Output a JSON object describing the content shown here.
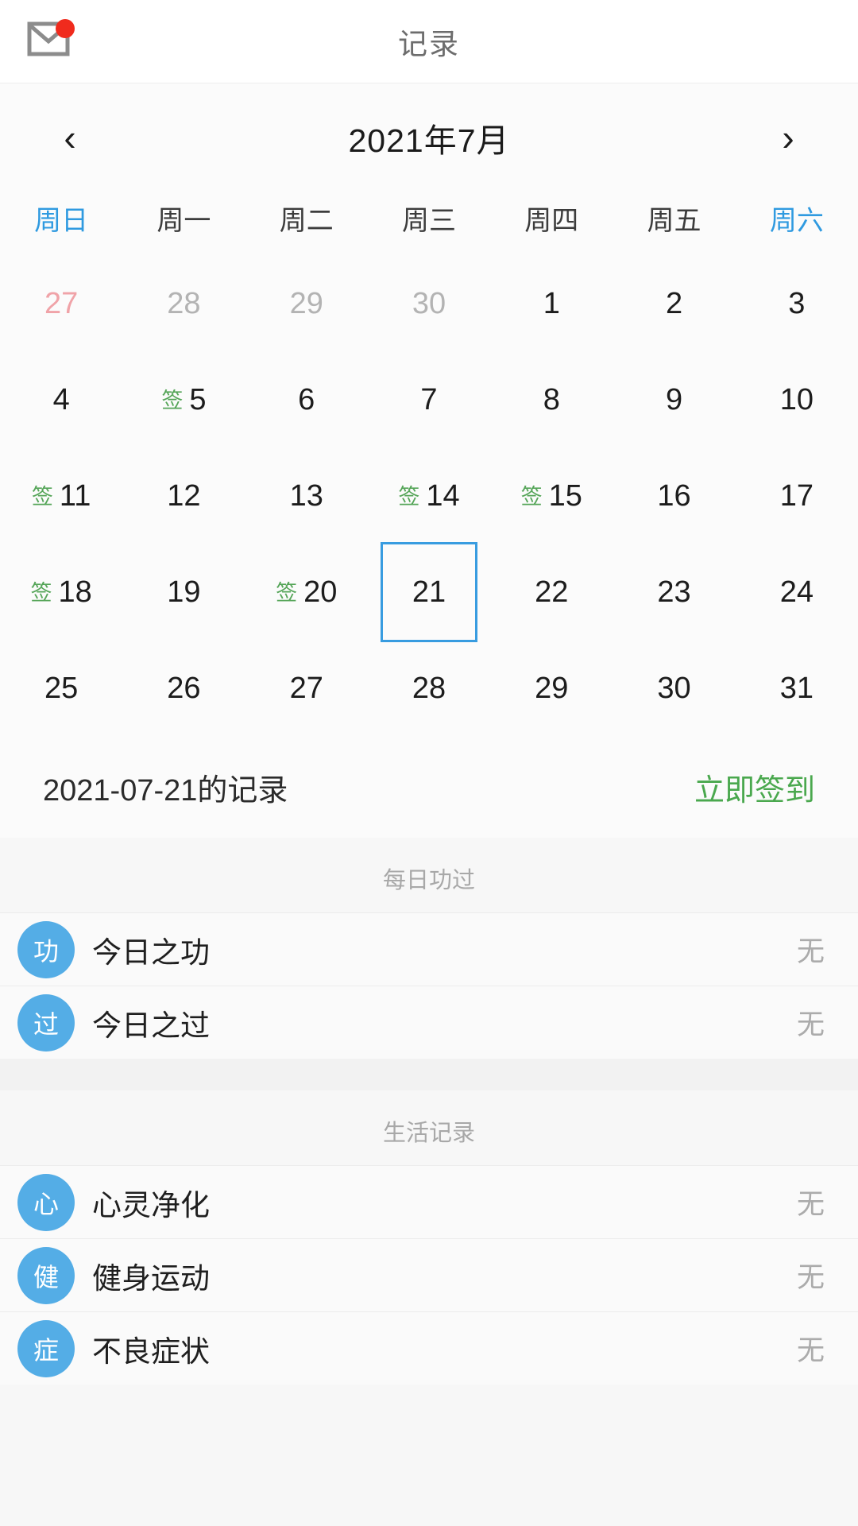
{
  "header": {
    "mail_icon": "mail-icon",
    "badge": "notification-dot",
    "title": "记录"
  },
  "calendar": {
    "prev_label": "‹",
    "next_label": "›",
    "month_label": "2021年7月",
    "weekdays": [
      {
        "label": "周日",
        "accent": true
      },
      {
        "label": "周一",
        "accent": false
      },
      {
        "label": "周二",
        "accent": false
      },
      {
        "label": "周三",
        "accent": false
      },
      {
        "label": "周四",
        "accent": false
      },
      {
        "label": "周五",
        "accent": false
      },
      {
        "label": "周六",
        "accent": true
      }
    ],
    "sign_mark": "签",
    "weeks": [
      [
        {
          "day": "27",
          "state": "pink",
          "signed": false,
          "selected": false
        },
        {
          "day": "28",
          "state": "muted",
          "signed": false,
          "selected": false
        },
        {
          "day": "29",
          "state": "muted",
          "signed": false,
          "selected": false
        },
        {
          "day": "30",
          "state": "muted",
          "signed": false,
          "selected": false
        },
        {
          "day": "1",
          "state": "current",
          "signed": false,
          "selected": false
        },
        {
          "day": "2",
          "state": "current",
          "signed": false,
          "selected": false
        },
        {
          "day": "3",
          "state": "current",
          "signed": false,
          "selected": false
        }
      ],
      [
        {
          "day": "4",
          "state": "current",
          "signed": false,
          "selected": false
        },
        {
          "day": "5",
          "state": "current",
          "signed": true,
          "selected": false
        },
        {
          "day": "6",
          "state": "current",
          "signed": false,
          "selected": false
        },
        {
          "day": "7",
          "state": "current",
          "signed": false,
          "selected": false
        },
        {
          "day": "8",
          "state": "current",
          "signed": false,
          "selected": false
        },
        {
          "day": "9",
          "state": "current",
          "signed": false,
          "selected": false
        },
        {
          "day": "10",
          "state": "current",
          "signed": false,
          "selected": false
        }
      ],
      [
        {
          "day": "11",
          "state": "current",
          "signed": true,
          "selected": false
        },
        {
          "day": "12",
          "state": "current",
          "signed": false,
          "selected": false
        },
        {
          "day": "13",
          "state": "current",
          "signed": false,
          "selected": false
        },
        {
          "day": "14",
          "state": "current",
          "signed": true,
          "selected": false
        },
        {
          "day": "15",
          "state": "current",
          "signed": true,
          "selected": false
        },
        {
          "day": "16",
          "state": "current",
          "signed": false,
          "selected": false
        },
        {
          "day": "17",
          "state": "current",
          "signed": false,
          "selected": false
        }
      ],
      [
        {
          "day": "18",
          "state": "current",
          "signed": true,
          "selected": false
        },
        {
          "day": "19",
          "state": "current",
          "signed": false,
          "selected": false
        },
        {
          "day": "20",
          "state": "current",
          "signed": true,
          "selected": false
        },
        {
          "day": "21",
          "state": "current",
          "signed": false,
          "selected": true
        },
        {
          "day": "22",
          "state": "current",
          "signed": false,
          "selected": false
        },
        {
          "day": "23",
          "state": "current",
          "signed": false,
          "selected": false
        },
        {
          "day": "24",
          "state": "current",
          "signed": false,
          "selected": false
        }
      ],
      [
        {
          "day": "25",
          "state": "current",
          "signed": false,
          "selected": false
        },
        {
          "day": "26",
          "state": "current",
          "signed": false,
          "selected": false
        },
        {
          "day": "27",
          "state": "current",
          "signed": false,
          "selected": false
        },
        {
          "day": "28",
          "state": "current",
          "signed": false,
          "selected": false
        },
        {
          "day": "29",
          "state": "current",
          "signed": false,
          "selected": false
        },
        {
          "day": "30",
          "state": "current",
          "signed": false,
          "selected": false
        },
        {
          "day": "31",
          "state": "current",
          "signed": false,
          "selected": false
        }
      ]
    ]
  },
  "record_header": {
    "title": "2021-07-21的记录",
    "action": "立即签到"
  },
  "sections": [
    {
      "title": "每日功过",
      "rows": [
        {
          "avatar": "功",
          "label": "今日之功",
          "value": "无"
        },
        {
          "avatar": "过",
          "label": "今日之过",
          "value": "无"
        }
      ]
    },
    {
      "title": "生活记录",
      "rows": [
        {
          "avatar": "心",
          "label": "心灵净化",
          "value": "无"
        },
        {
          "avatar": "健",
          "label": "健身运动",
          "value": "无"
        },
        {
          "avatar": "症",
          "label": "不良症状",
          "value": "无"
        }
      ]
    }
  ],
  "colors": {
    "accent_blue": "#2f9ae0",
    "avatar_blue": "#54ade6",
    "sign_green": "#55a558",
    "action_green": "#4aa84e",
    "badge_red": "#f02b1d",
    "muted_gray": "#b3b3b3",
    "pink_day": "#f0a3a8"
  }
}
